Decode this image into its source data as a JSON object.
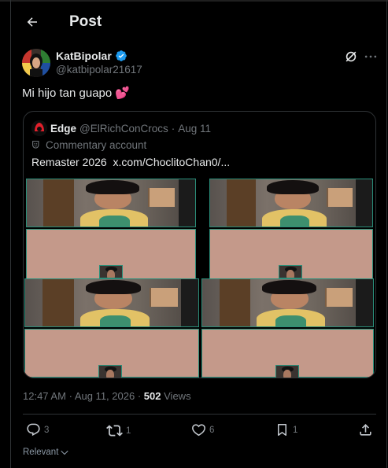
{
  "header": {
    "title": "Post"
  },
  "author": {
    "name": "KatBipolar",
    "handle": "@katbipolar21617",
    "verified": true
  },
  "post": {
    "text": "Mi hijo tan guapo",
    "emoji": "💕"
  },
  "quote": {
    "name": "Edge",
    "handle": "@ElRichConCrocs",
    "separator": "·",
    "date": "Aug 11",
    "label": "Commentary account",
    "text_prefix": "Remaster 2026 ",
    "link": "x.com/ChoclitoChan0/..."
  },
  "meta": {
    "time": "12:47 AM",
    "separator": "·",
    "date": "Aug 11, 2026",
    "separator2": "·",
    "views_count": "502",
    "views_label": "Views"
  },
  "actions": {
    "replies": "3",
    "reposts": "1",
    "likes": "6",
    "bookmarks": "1"
  },
  "sort": {
    "label": "Relevant"
  },
  "colors": {
    "accent": "#1d9bf0",
    "muted": "#71767b",
    "text": "#e7e9ea",
    "border": "#2f3336",
    "heart": "#f91880"
  },
  "icons": [
    "back-arrow-icon",
    "verified-badge-icon",
    "grok-icon",
    "more-icon",
    "theater-mask-icon",
    "reply-icon",
    "repost-icon",
    "like-icon",
    "bookmark-icon",
    "share-icon",
    "chevron-down-icon"
  ]
}
